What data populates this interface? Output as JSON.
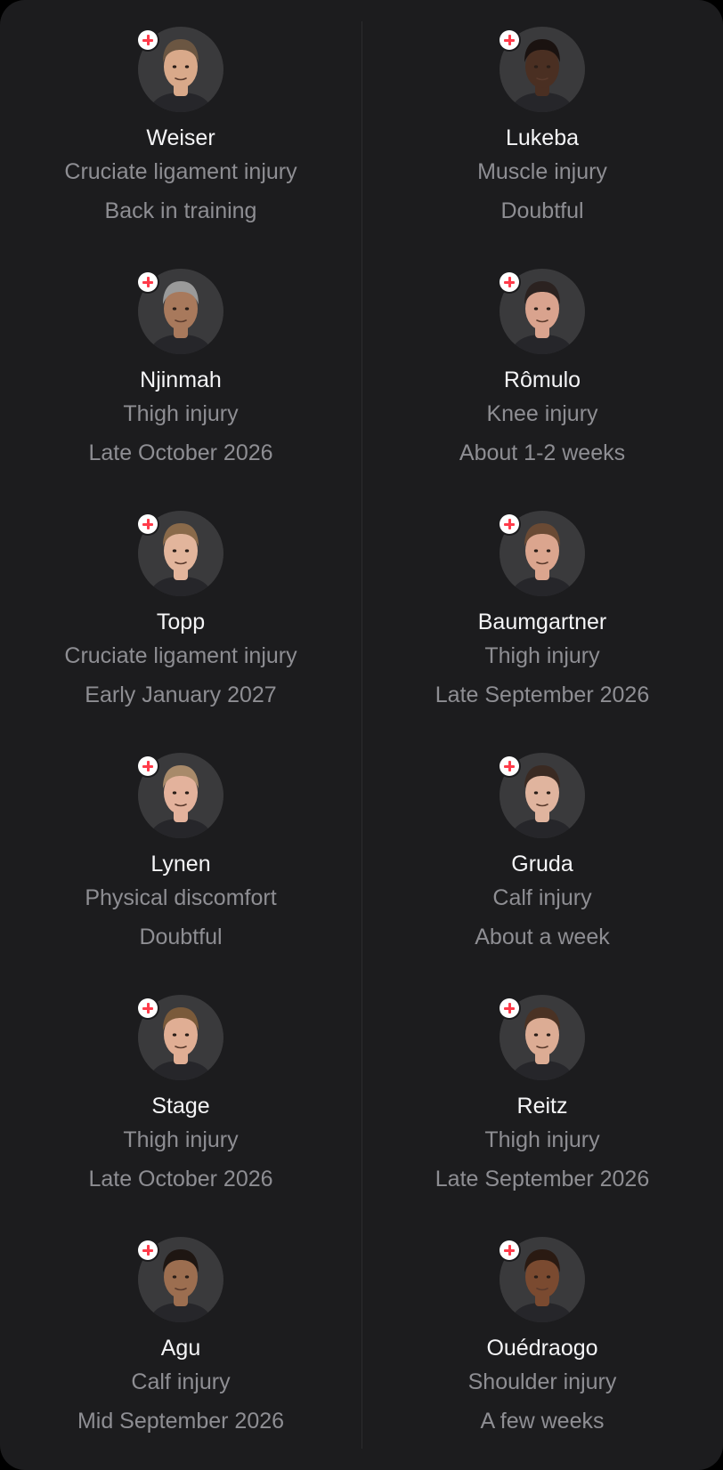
{
  "injury_list": {
    "players": [
      {
        "name": "Weiser",
        "injury": "Cruciate ligament injury",
        "status": "Back in training",
        "skin": "#d9a98a",
        "hair": "#6b5642"
      },
      {
        "name": "Lukeba",
        "injury": "Muscle injury",
        "status": "Doubtful",
        "skin": "#4a2f22",
        "hair": "#1a1210"
      },
      {
        "name": "Njinmah",
        "injury": "Thigh injury",
        "status": "Late October 2026",
        "skin": "#a8795c",
        "hair": "#9a9a9a"
      },
      {
        "name": "Rômulo",
        "injury": "Knee injury",
        "status": "About 1-2 weeks",
        "skin": "#d9a38e",
        "hair": "#2b2220"
      },
      {
        "name": "Topp",
        "injury": "Cruciate ligament injury",
        "status": "Early January 2027",
        "skin": "#e2b59c",
        "hair": "#8a6a4a"
      },
      {
        "name": "Baumgartner",
        "injury": "Thigh injury",
        "status": "Late September 2026",
        "skin": "#dba58e",
        "hair": "#6a4a34"
      },
      {
        "name": "Lynen",
        "injury": "Physical discomfort",
        "status": "Doubtful",
        "skin": "#e3b29c",
        "hair": "#a88a6a"
      },
      {
        "name": "Gruda",
        "injury": "Calf injury",
        "status": "About a week",
        "skin": "#e0b49e",
        "hair": "#3a2a22"
      },
      {
        "name": "Stage",
        "injury": "Thigh injury",
        "status": "Late October 2026",
        "skin": "#e0ae94",
        "hair": "#7a5a3a"
      },
      {
        "name": "Reitz",
        "injury": "Thigh injury",
        "status": "Late September 2026",
        "skin": "#dcac94",
        "hair": "#4a3224"
      },
      {
        "name": "Agu",
        "injury": "Calf injury",
        "status": "Mid September 2026",
        "skin": "#9c6e50",
        "hair": "#1e1612"
      },
      {
        "name": "Ouédraogo",
        "injury": "Shoulder injury",
        "status": "A few weeks",
        "skin": "#7a4a30",
        "hair": "#2a1a12"
      }
    ]
  },
  "colors": {
    "card_background": "#1c1c1e",
    "name_text": "#f5f5f7",
    "secondary_text": "#8e8e93",
    "badge_cross": "#ff3b4a"
  },
  "icons": {
    "badge": "injury-cross-icon",
    "avatar": "player-photo"
  }
}
